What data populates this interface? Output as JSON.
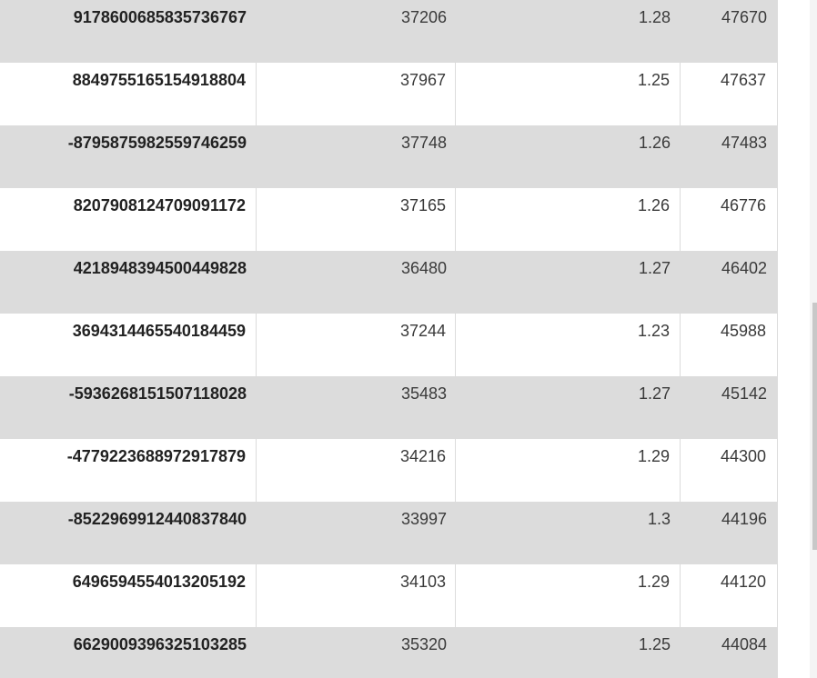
{
  "table": {
    "rows": [
      {
        "id": "9178600685835736767",
        "col2": "37206",
        "col3": "1.28",
        "col4": "47670"
      },
      {
        "id": "8849755165154918804",
        "col2": "37967",
        "col3": "1.25",
        "col4": "47637"
      },
      {
        "id": "-8795875982559746259",
        "col2": "37748",
        "col3": "1.26",
        "col4": "47483"
      },
      {
        "id": "8207908124709091172",
        "col2": "37165",
        "col3": "1.26",
        "col4": "46776"
      },
      {
        "id": "4218948394500449828",
        "col2": "36480",
        "col3": "1.27",
        "col4": "46402"
      },
      {
        "id": "3694314465540184459",
        "col2": "37244",
        "col3": "1.23",
        "col4": "45988"
      },
      {
        "id": "-5936268151507118028",
        "col2": "35483",
        "col3": "1.27",
        "col4": "45142"
      },
      {
        "id": "-4779223688972917879",
        "col2": "34216",
        "col3": "1.29",
        "col4": "44300"
      },
      {
        "id": "-8522969912440837840",
        "col2": "33997",
        "col3": "1.3",
        "col4": "44196"
      },
      {
        "id": "6496594554013205192",
        "col2": "34103",
        "col3": "1.29",
        "col4": "44120"
      },
      {
        "id": "6629009396325103285",
        "col2": "35320",
        "col3": "1.25",
        "col4": "44084"
      }
    ]
  },
  "colors": {
    "row_shaded": "#dcdcdc",
    "row_plain": "#ffffff",
    "text_bold": "#222222",
    "text": "#3a3a3a"
  }
}
